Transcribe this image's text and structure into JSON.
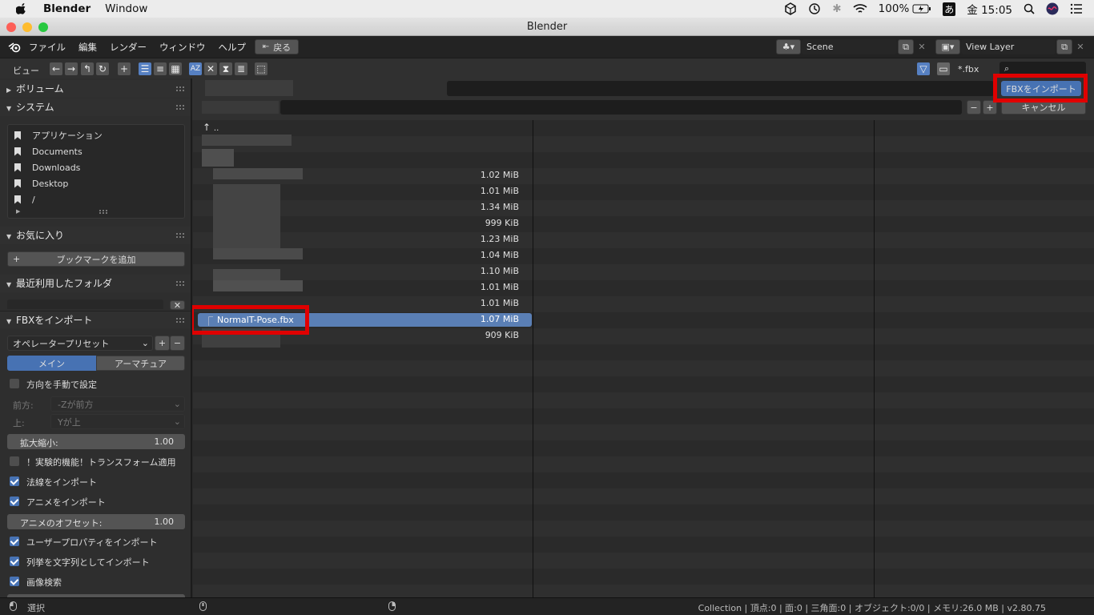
{
  "macbar": {
    "app": "Blender",
    "window_menu": "Window",
    "battery": "100%",
    "ime": "あ",
    "clock": "金 15:05"
  },
  "window": {
    "title": "Blender"
  },
  "topbar": {
    "menus": [
      "ファイル",
      "編集",
      "レンダー",
      "ウィンドウ",
      "ヘルプ"
    ],
    "back": "戻る",
    "scene": "Scene",
    "view_layer": "View Layer"
  },
  "header": {
    "view_label": "ビュー",
    "filter_text": "*.fbx",
    "search_placeholder": ""
  },
  "actions": {
    "import_label": "FBXをインポート",
    "cancel_label": "キャンセル"
  },
  "sidebar": {
    "volumes": "ボリューム",
    "system": "システム",
    "system_items": [
      "アプリケーション",
      "Documents",
      "Downloads",
      "Desktop",
      "/"
    ],
    "favorites": "お気に入り",
    "add_bookmark": "ブックマークを追加",
    "recent": "最近利用したフォルダ",
    "import_panel": "FBXをインポート",
    "preset": "オペレータープリセット",
    "tabs": [
      "メイン",
      "アーマチュア"
    ],
    "manual_orient": "方向を手動で設定",
    "forward_label": "前方:",
    "forward_value": "-Zが前方",
    "up_label": "上:",
    "up_value": "Yが上",
    "scale_label": "拡大縮小:",
    "scale_value": "1.00",
    "apply_transform": "！実験的機能！トランスフォーム適用",
    "import_normals": "法線をインポート",
    "import_anim": "アニメをインポート",
    "anim_offset_label": "アニメのオフセット:",
    "anim_offset_value": "1.00",
    "import_user_props": "ユーザープロパティをインポート",
    "enum_as_string": "列挙を文字列としてインポート",
    "image_search": "画像検索"
  },
  "files": {
    "parent": "..",
    "sizes": [
      "1.02 MiB",
      "1.01 MiB",
      "1.34 MiB",
      "999 KiB",
      "1.23 MiB",
      "1.04 MiB",
      "1.10 MiB",
      "1.01 MiB",
      "1.01 MiB",
      "1.07 MiB",
      "909 KiB"
    ],
    "selected_name": "NormalT-Pose.fbx"
  },
  "status": {
    "select": "選択",
    "info": "Collection | 頂点:0 | 面:0 | 三角面:0 | オブジェクト:0/0 | メモリ:26.0 MB | v2.80.75"
  },
  "colors": {
    "accent": "#4772b3",
    "highlight": "#e00000",
    "selected_row": "#5a7fb5"
  }
}
